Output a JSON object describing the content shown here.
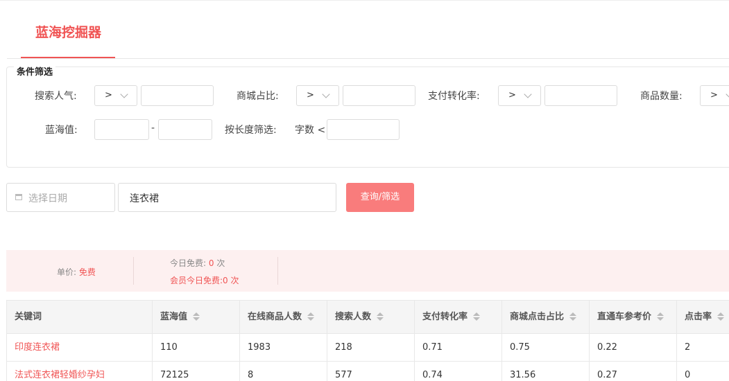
{
  "tab": {
    "title": "蓝海挖掘器"
  },
  "filters": {
    "legend": "条件筛选",
    "search_popularity": {
      "label": "搜索人气:",
      "op": ">"
    },
    "mall_ratio": {
      "label": "商城占比:",
      "op": ">"
    },
    "pay_conversion": {
      "label": "支付转化率:",
      "op": ">"
    },
    "product_count": {
      "label": "商品数量:",
      "op": ">"
    },
    "blue_sea_value": {
      "label": "蓝海值:",
      "dash": "-"
    },
    "length_filter": {
      "label": "按长度筛选:",
      "word_count": "字数 <"
    }
  },
  "search": {
    "date_placeholder": "选择日期",
    "keyword_value": "连衣裙",
    "query_button": "查询/筛选"
  },
  "pricing": {
    "unit_price_label": "单价: ",
    "unit_price_value": "免费",
    "today_free_prefix": "今日免费: ",
    "today_free_count": "0",
    "today_free_suffix": " 次",
    "member_today_free": "会员今日免费:0 次"
  },
  "table": {
    "columns": [
      "关键词",
      "蓝海值",
      "在线商品人数",
      "搜索人数",
      "支付转化率",
      "商城点击占比",
      "直通车参考价",
      "点击率"
    ],
    "rows": [
      [
        "印度连衣裙",
        "110",
        "1983",
        "218",
        "0.71",
        "0.75",
        "0.22",
        "2"
      ],
      [
        "法式连衣裙轻婚纱孕妇",
        "72125",
        "8",
        "577",
        "0.74",
        "31.56",
        "0.27",
        "0"
      ]
    ]
  },
  "colors": {
    "accent": "#f05454",
    "button": "#f97c7c",
    "price_bar_bg": "#fdf0f0"
  },
  "icons": {
    "calendar": "calendar-icon",
    "chevron": "chevron-down-icon",
    "sort": "sort-icon"
  }
}
